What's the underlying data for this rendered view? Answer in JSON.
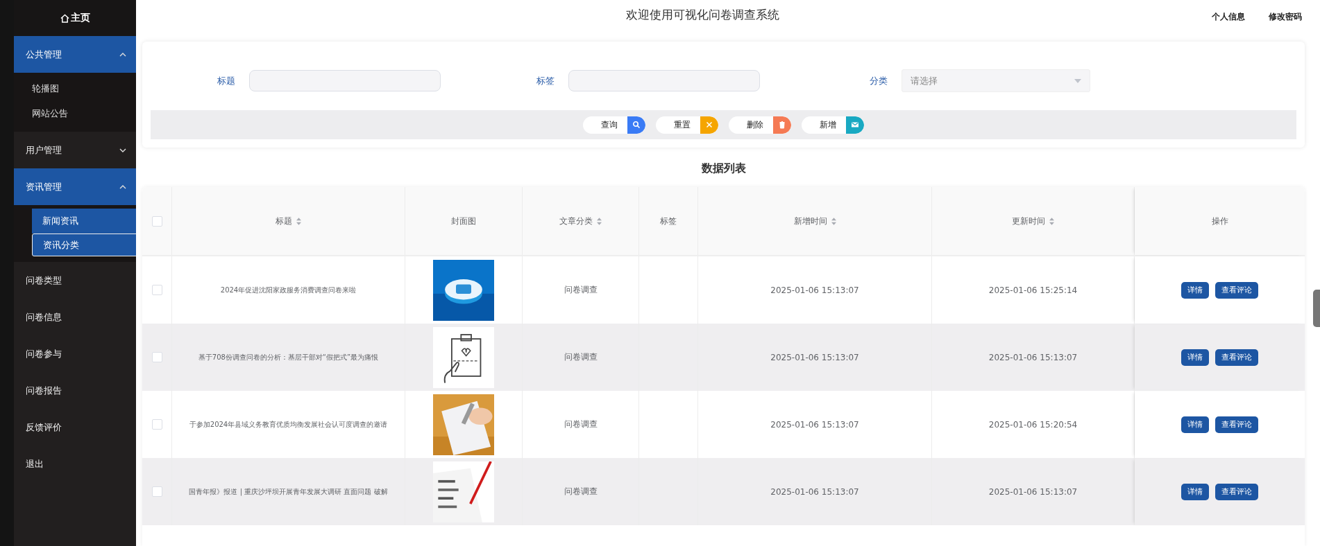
{
  "sidebar": {
    "home": "主页",
    "groups": [
      {
        "label": "公共管理",
        "expanded": true,
        "children": [
          {
            "label": "轮播图",
            "selected": false
          },
          {
            "label": "网站公告",
            "selected": false
          }
        ]
      },
      {
        "label": "用户管理",
        "expanded": false
      },
      {
        "label": "资讯管理",
        "expanded": true,
        "children": [
          {
            "label": "新闻资讯",
            "selected": false
          },
          {
            "label": "资讯分类",
            "selected": true
          }
        ]
      },
      {
        "label": "问卷类型"
      },
      {
        "label": "问卷信息"
      },
      {
        "label": "问卷参与"
      },
      {
        "label": "问卷报告"
      },
      {
        "label": "反馈评价"
      },
      {
        "label": "退出"
      }
    ]
  },
  "header": {
    "title": "欢迎使用可视化问卷调查系统",
    "links": [
      "个人信息",
      "修改密码"
    ]
  },
  "search": {
    "fields": [
      {
        "kind": "text",
        "label": "标题"
      },
      {
        "kind": "text",
        "label": "标签"
      },
      {
        "kind": "select",
        "label": "分类",
        "placeholder": "请选择"
      }
    ],
    "buttons": [
      {
        "label": "查询",
        "kind": "search"
      },
      {
        "label": "重置",
        "kind": "reset"
      },
      {
        "label": "删除",
        "kind": "delete"
      },
      {
        "label": "新增",
        "kind": "add"
      }
    ]
  },
  "table": {
    "title": "数据列表",
    "select_all_checked": false,
    "columns": [
      {
        "label": "标题",
        "sortable": true
      },
      {
        "label": "封面图",
        "sortable": false
      },
      {
        "label": "文章分类",
        "sortable": true
      },
      {
        "label": "标签",
        "sortable": false
      },
      {
        "label": "新增时间",
        "sortable": true
      },
      {
        "label": "更新时间",
        "sortable": true
      },
      {
        "label": "操作",
        "sortable": false
      }
    ],
    "rows": [
      {
        "checked": false,
        "title": "2024年促进沈阳家政服务消费调查问卷来啦",
        "cover": {
          "kind": "picture"
        },
        "category": "问卷调查",
        "created": "2025-01-06 15:13:07",
        "updated": "2025-01-06 15:25:14",
        "actions": [
          "详情",
          "查看评论"
        ]
      },
      {
        "checked": false,
        "title": "基于708份调查问卷的分析：基层干部对“假把式”最为痛恨",
        "cover": {
          "kind": "picture"
        },
        "category": "问卷调查",
        "created": "2025-01-06 15:13:07",
        "updated": "2025-01-06 15:13:07",
        "actions": [
          "详情",
          "查看评论"
        ]
      },
      {
        "checked": false,
        "title": "于参加2024年县域义务教育优质均衡发展社会认可度调查的邀请",
        "cover": {
          "kind": "picture"
        },
        "category": "问卷调查",
        "created": "2025-01-06 15:13:07",
        "updated": "2025-01-06 15:20:54",
        "actions": [
          "详情",
          "查看评论"
        ]
      },
      {
        "checked": false,
        "title": "国青年报》报道 | 重庆沙坪坝开展青年发展大调研 直面问题 破解",
        "cover": {
          "kind": "picture"
        },
        "category": "问卷调查",
        "created": "2025-01-06 15:13:07",
        "updated": "2025-01-06 15:13:07",
        "actions": [
          "详情",
          "查看评论"
        ]
      }
    ]
  }
}
